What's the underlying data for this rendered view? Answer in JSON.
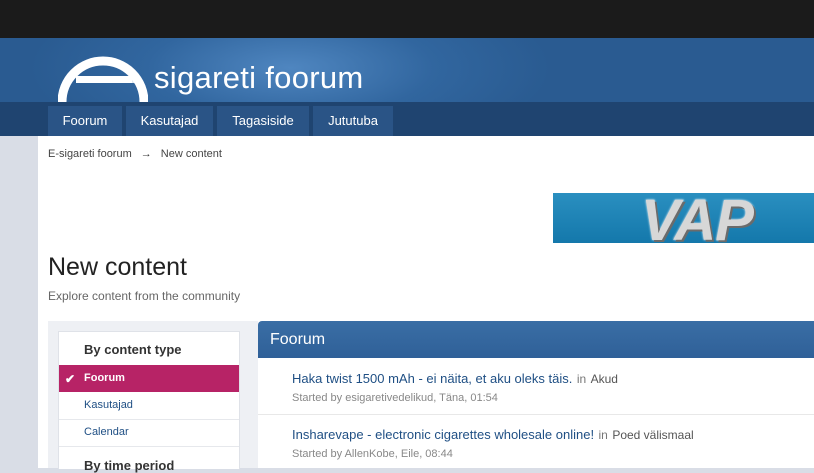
{
  "site": {
    "title": "sigareti foorum"
  },
  "nav": {
    "items": [
      {
        "label": "Foorum"
      },
      {
        "label": "Kasutajad"
      },
      {
        "label": "Tagasiside"
      },
      {
        "label": "Jututuba"
      }
    ]
  },
  "breadcrumb": {
    "items": [
      "E-sigareti foorum",
      "New content"
    ],
    "separator": "→"
  },
  "banner": {
    "text": "VAP"
  },
  "page": {
    "title": "New content",
    "subtitle": "Explore content from the community"
  },
  "sidebar": {
    "heading": "By content type",
    "items": [
      {
        "label": "Foorum",
        "active": true
      },
      {
        "label": "Kasutajad",
        "active": false
      },
      {
        "label": "Calendar",
        "active": false
      }
    ],
    "heading2": "By time period"
  },
  "results": {
    "section_title": "Foorum",
    "topics": [
      {
        "title": "Haka twist 1500 mAh - ei näita, et aku oleks täis.",
        "in": "in",
        "forum": "Akud",
        "meta": "Started by esigaretivedelikud, Täna, 01:54"
      },
      {
        "title": "Insharevape - electronic cigarettes wholesale online!",
        "in": "in",
        "forum": "Poed välismaal",
        "meta": "Started by AllenKobe, Eile, 08:44"
      }
    ]
  },
  "colors": {
    "header": "#2f6399",
    "nav": "#1f4470",
    "active": "#b72366",
    "link": "#1f4f84"
  }
}
